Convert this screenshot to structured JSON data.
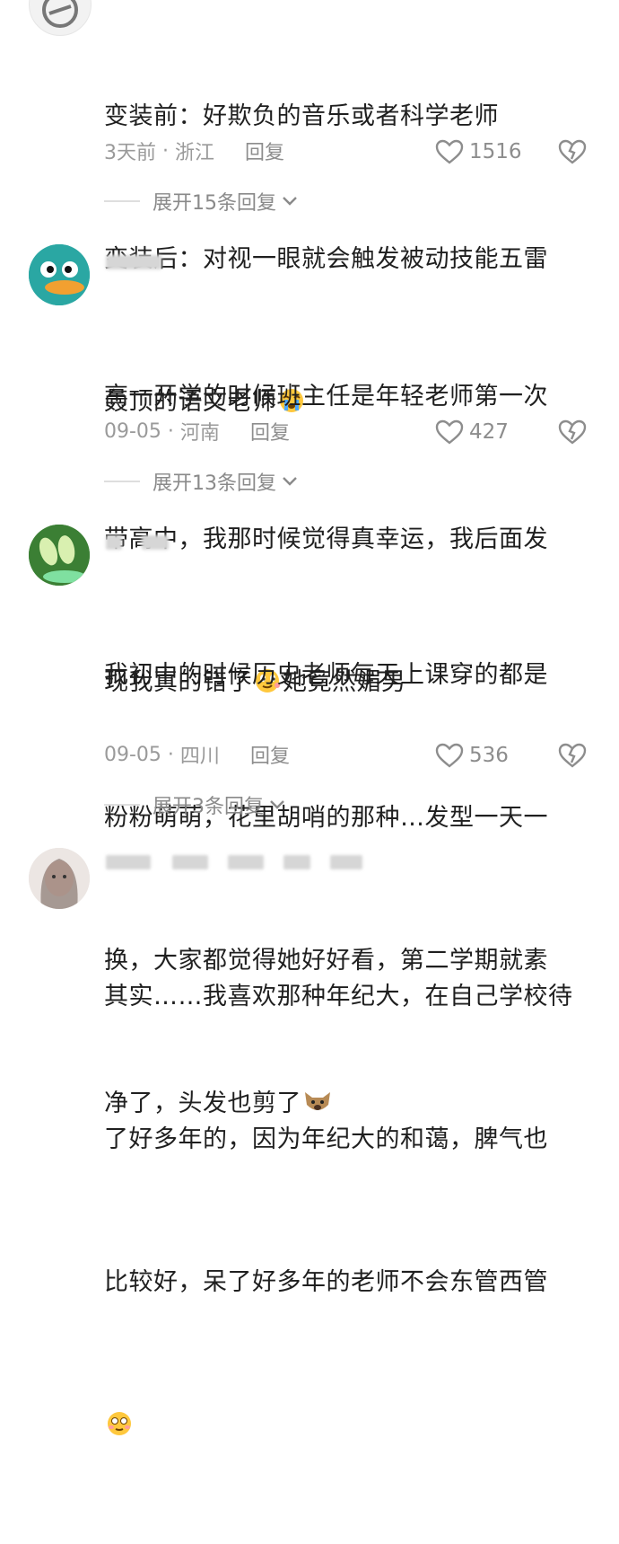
{
  "comments": [
    {
      "lines": [
        "变装前：好欺负的音乐或者科学老师",
        "变装后：对视一眼就会触发被动技能五雷",
        "轰顶的语文老师"
      ],
      "emoji": "crying-face",
      "time": "3天前",
      "location": "浙江",
      "reply_label": "回复",
      "likes": "1516",
      "expand_label": "展开15条回复"
    },
    {
      "lines": [
        "高一开学的时候班主任是年轻老师第一次",
        "带高中，我那时候觉得真幸运，我后面发",
        "现我真的错了",
        "她竟然媚男"
      ],
      "emoji": "smirk-face",
      "time": "09-05",
      "location": "河南",
      "reply_label": "回复",
      "likes": "427",
      "expand_label": "展开13条回复"
    },
    {
      "lines": [
        "我初中的时候历史老师每天上课穿的都是",
        "粉粉萌萌，花里胡哨的那种…发型一天一",
        "换，大家都觉得她好好看，第二学期就素",
        "净了，头发也剪了"
      ],
      "emoji": "dog-face",
      "time": "09-05",
      "location": "四川",
      "reply_label": "回复",
      "likes": "536",
      "expand_label": "展开3条回复"
    },
    {
      "lines": [
        "其实……我喜欢那种年纪大，在自己学校待",
        "了好多年的，因为年纪大的和蔼，脾气也",
        "比较好，呆了好多年的老师不会东管西管"
      ],
      "emoji": "blush-face"
    }
  ],
  "colors": {
    "meta": "#9a9a9a",
    "text": "#1f1f1f",
    "divider": "#dedede"
  }
}
